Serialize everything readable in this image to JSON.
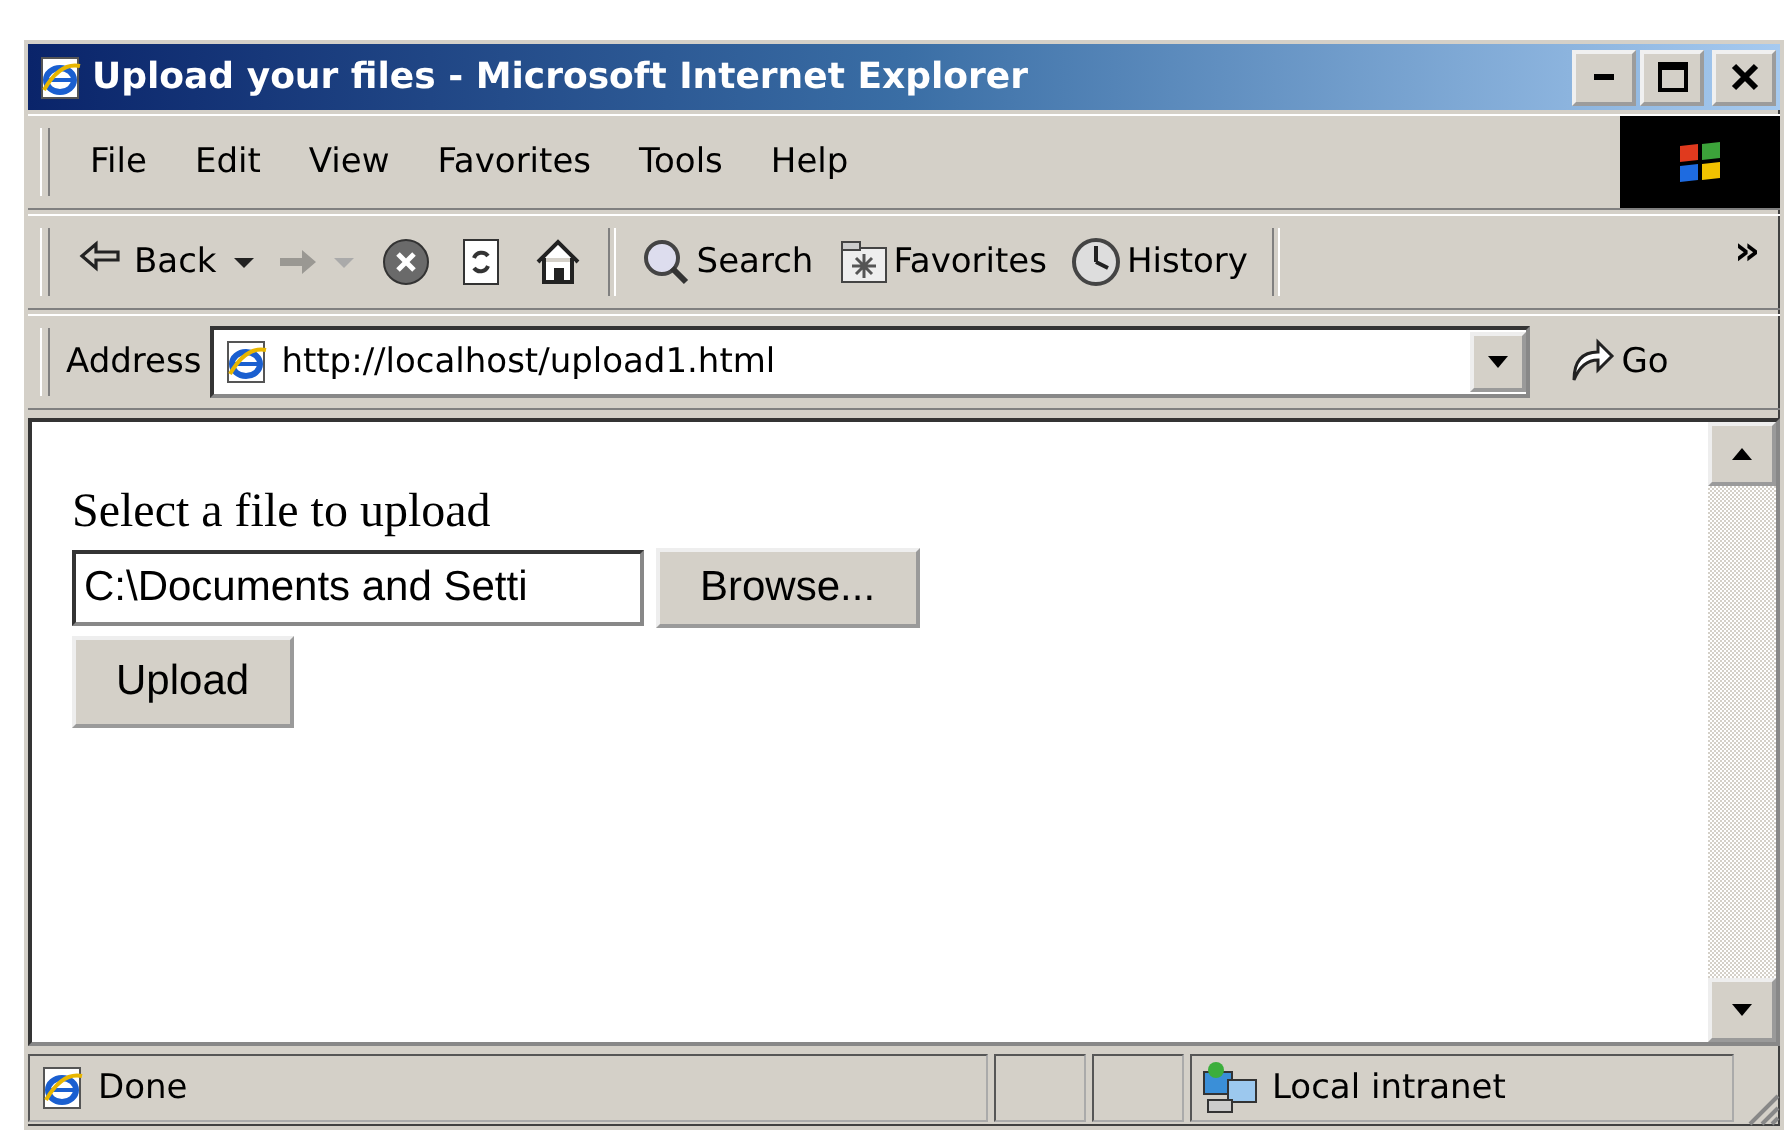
{
  "window": {
    "title": "Upload your files - Microsoft Internet Explorer"
  },
  "menu": [
    "File",
    "Edit",
    "View",
    "Favorites",
    "Tools",
    "Help"
  ],
  "toolbar": [
    {
      "kind": "back",
      "label": "Back",
      "disabled": false
    },
    {
      "kind": "forward",
      "disabled": true
    },
    {
      "kind": "stop",
      "disabled": false
    },
    {
      "kind": "refresh",
      "disabled": false
    },
    {
      "kind": "home",
      "disabled": false
    },
    {
      "kind": "search",
      "label": "Search",
      "disabled": false
    },
    {
      "kind": "favorites",
      "label": "Favorites",
      "disabled": false
    },
    {
      "kind": "history",
      "label": "History",
      "disabled": false
    }
  ],
  "toolbar_more": "»",
  "address": {
    "label": "Address",
    "value": "http://localhost/upload1.html",
    "go": "Go"
  },
  "page": {
    "prompt": "Select a file to upload",
    "file_value": "C:\\Documents and Setti",
    "browse": "Browse...",
    "submit": "Upload"
  },
  "status_bar": {
    "text": "Done",
    "zone": "Local intranet"
  }
}
